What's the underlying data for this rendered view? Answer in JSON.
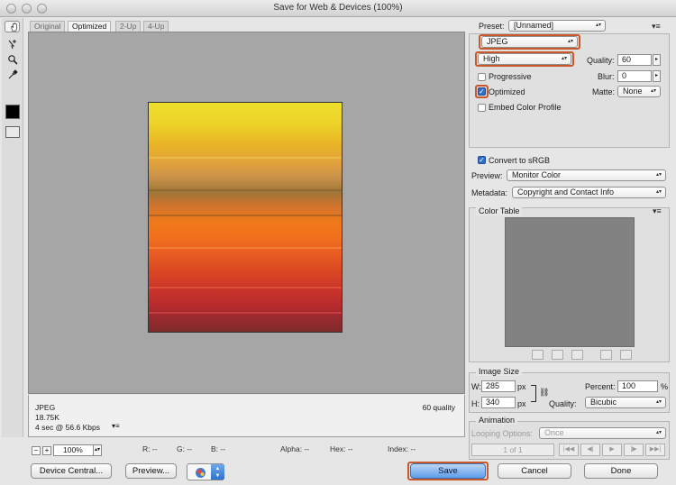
{
  "window": {
    "title": "Save for Web & Devices (100%)"
  },
  "tabs": [
    "Original",
    "Optimized",
    "2-Up",
    "4-Up"
  ],
  "info": {
    "format": "JPEG",
    "size": "18.75K",
    "time": "4 sec @ 56.6 Kbps",
    "quality_note": "60 quality"
  },
  "status": {
    "zoom": "100%",
    "r": "R: --",
    "g": "G: --",
    "b": "B: --",
    "alpha": "Alpha: --",
    "hex": "Hex: --",
    "index": "Index: --"
  },
  "buttons": {
    "device_central": "Device Central...",
    "preview": "Preview...",
    "save": "Save",
    "cancel": "Cancel",
    "done": "Done"
  },
  "settings": {
    "preset_label": "Preset:",
    "preset_value": "[Unnamed]",
    "format_value": "JPEG",
    "quality_preset": "High",
    "quality_label": "Quality:",
    "quality_value": "60",
    "blur_label": "Blur:",
    "blur_value": "0",
    "matte_label": "Matte:",
    "matte_value": "None",
    "progressive_label": "Progressive",
    "progressive_checked": false,
    "optimized_label": "Optimized",
    "optimized_checked": true,
    "embed_label": "Embed Color Profile",
    "embed_checked": false,
    "convert_label": "Convert to sRGB",
    "convert_checked": true,
    "preview_label": "Preview:",
    "preview_value": "Monitor Color",
    "metadata_label": "Metadata:",
    "metadata_value": "Copyright and Contact Info"
  },
  "color_table": {
    "title": "Color Table"
  },
  "image_size": {
    "title": "Image Size",
    "w_label": "W:",
    "w_value": "285",
    "h_label": "H:",
    "h_value": "340",
    "unit": "px",
    "percent_label": "Percent:",
    "percent_value": "100",
    "percent_unit": "%",
    "quality_label": "Quality:",
    "quality_value": "Bicubic"
  },
  "animation": {
    "title": "Animation",
    "looping_label": "Looping Options:",
    "looping_value": "Once",
    "frame": "1 of 1"
  },
  "colors": {
    "highlight": "#c9582a",
    "save_button": "#5d9ce8",
    "checkbox": "#2f6fc8"
  }
}
